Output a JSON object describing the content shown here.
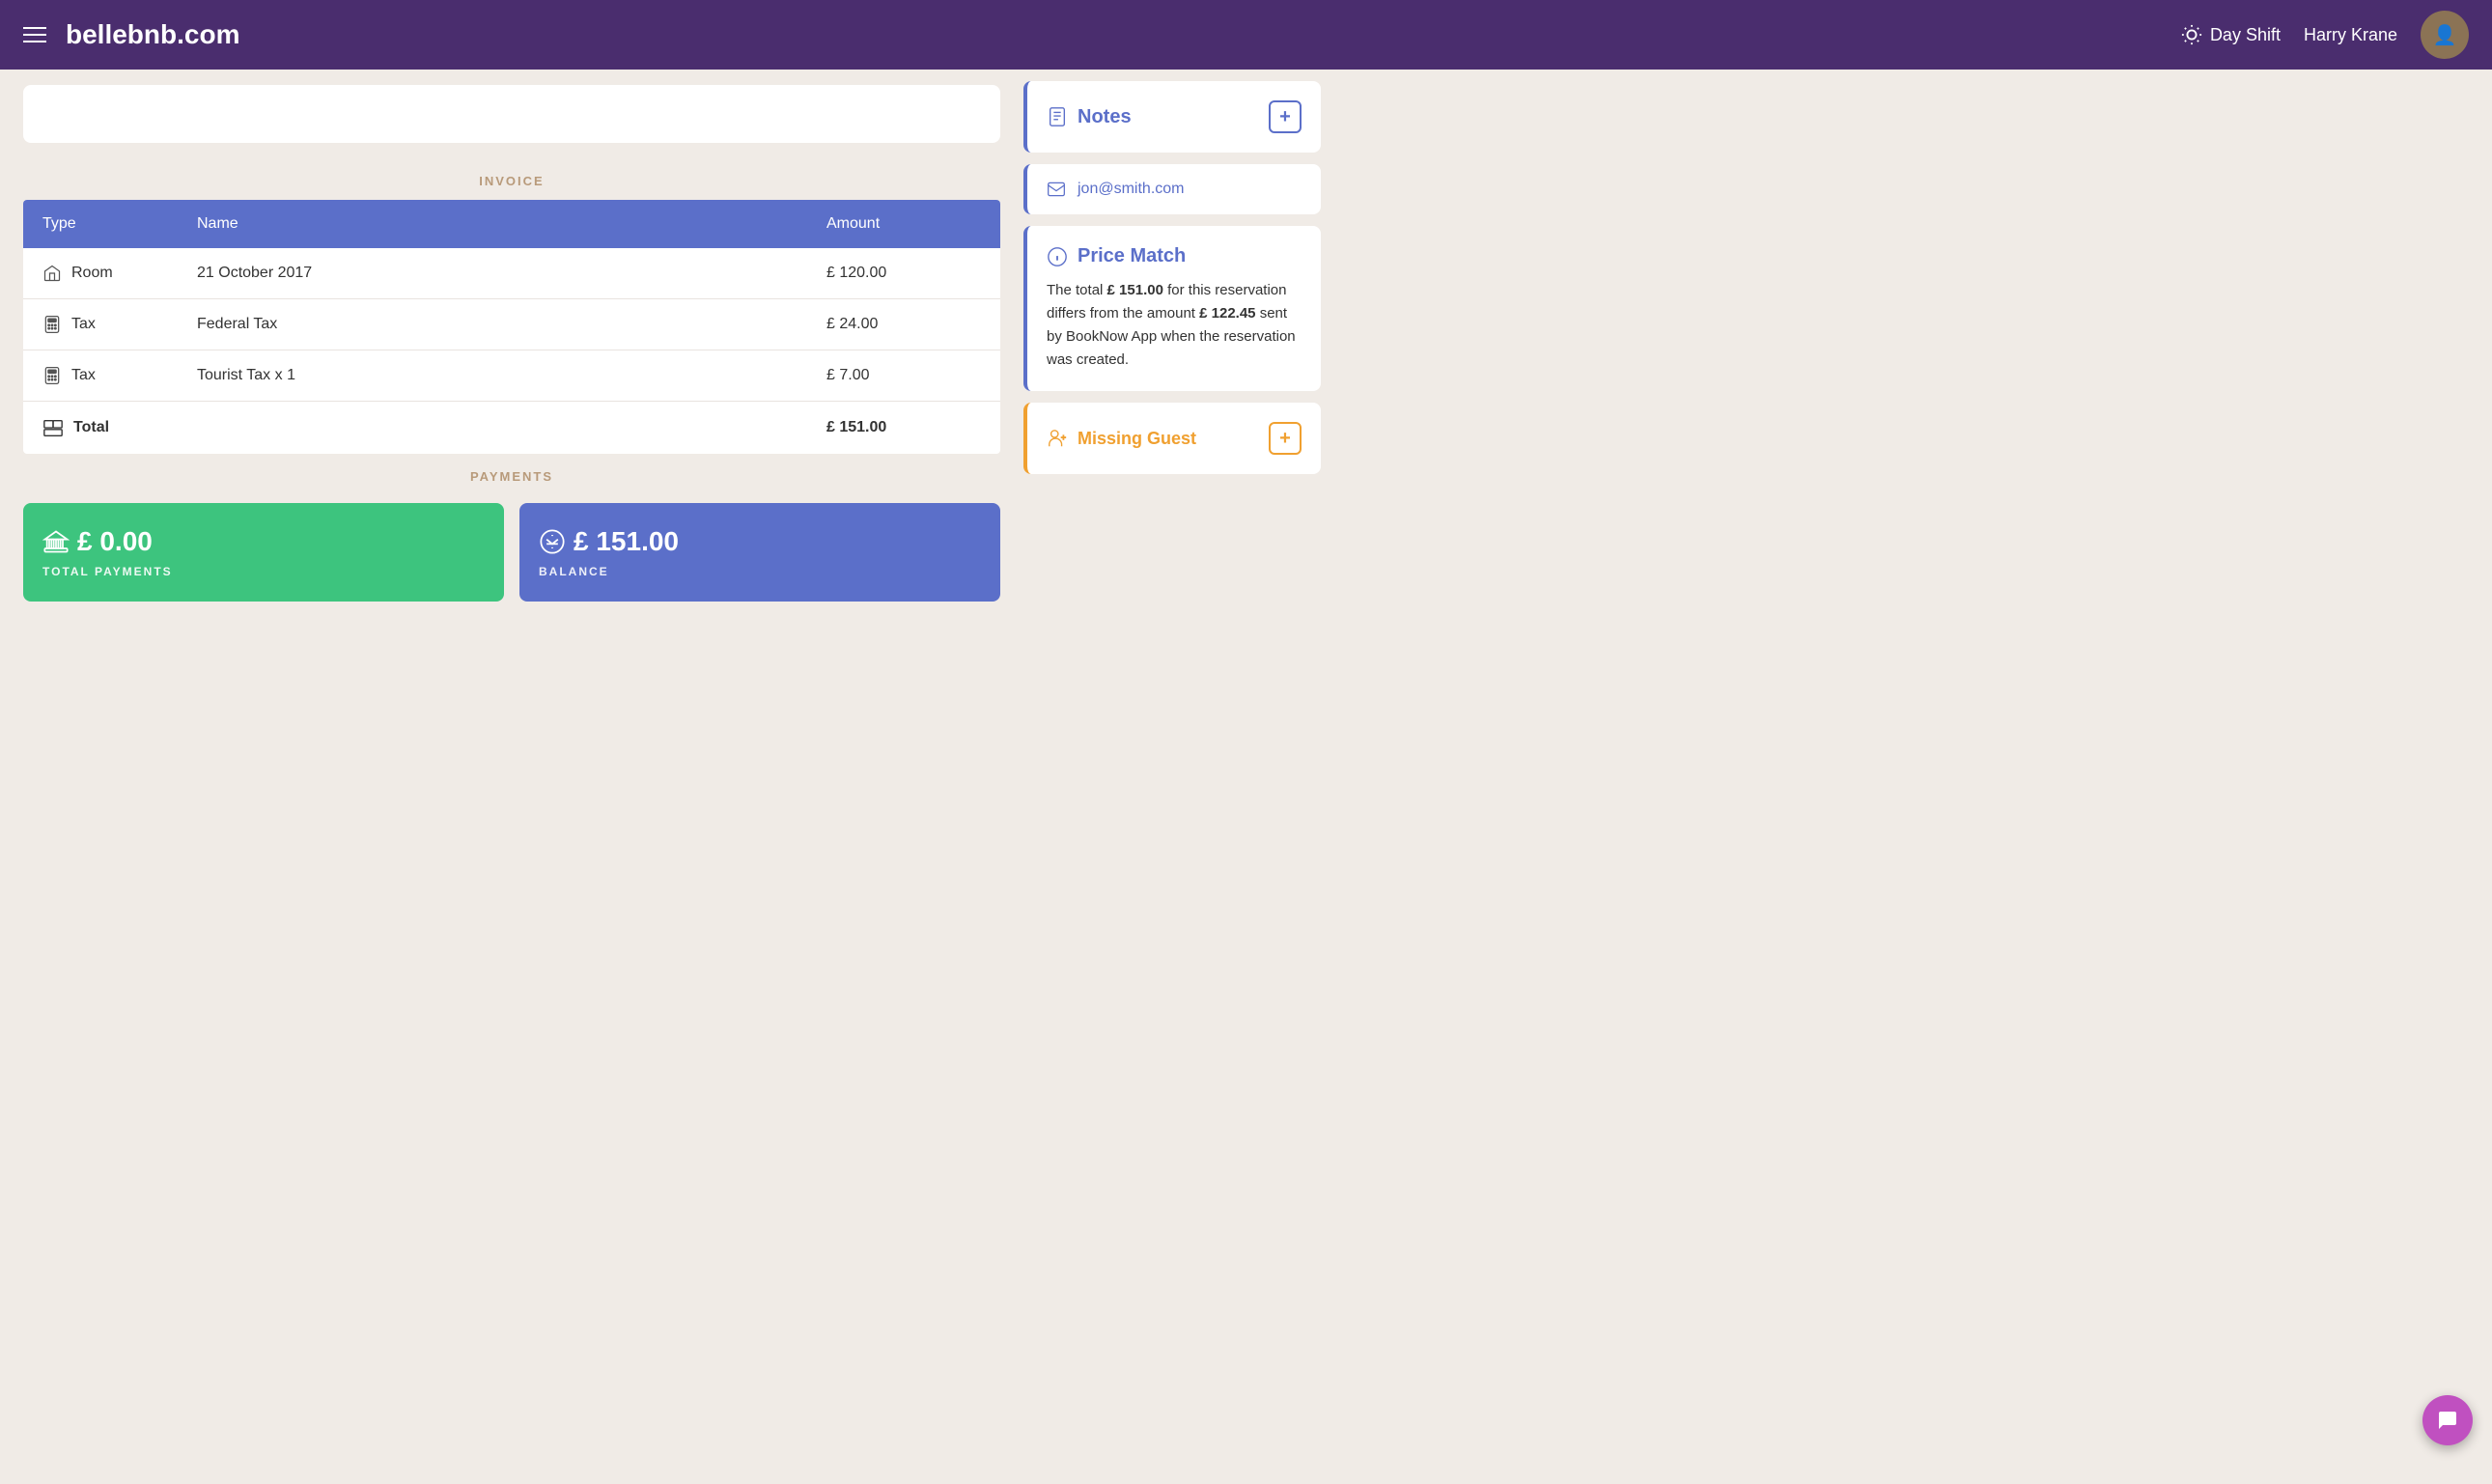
{
  "header": {
    "logo": "bellebnb.com",
    "shift": "Day Shift",
    "user": "Harry Krane"
  },
  "invoice": {
    "section_label": "INVOICE",
    "table": {
      "headers": [
        "Type",
        "Name",
        "Amount"
      ],
      "rows": [
        {
          "type": "Room",
          "type_icon": "home",
          "name": "21 October 2017",
          "amount": "£ 120.00"
        },
        {
          "type": "Tax",
          "type_icon": "calculator",
          "name": "Federal Tax",
          "amount": "£ 24.00"
        },
        {
          "type": "Tax",
          "type_icon": "calculator",
          "name": "Tourist Tax x 1",
          "amount": "£ 7.00"
        }
      ],
      "total_label": "Total",
      "total_amount": "£ 151.00"
    }
  },
  "payments": {
    "section_label": "PAYMENTS",
    "total_payments": {
      "amount": "£ 0.00",
      "label": "TOTAL PAYMENTS"
    },
    "balance": {
      "amount": "£ 151.00",
      "label": "BALANCE"
    }
  },
  "sidebar": {
    "notes": {
      "title": "Notes",
      "add_button": "+"
    },
    "email": {
      "value": "jon@smith.com"
    },
    "price_match": {
      "title": "Price Match",
      "text_before": "The total",
      "amount1": "£ 151.00",
      "text_middle": "for this reservation differs from the amount",
      "amount2": "£ 122.45",
      "text_after": "sent by BookNow App when the reservation was created."
    },
    "missing_guest": {
      "title": "Missing Guest",
      "add_button": "+"
    }
  },
  "chat_button_label": "💬"
}
